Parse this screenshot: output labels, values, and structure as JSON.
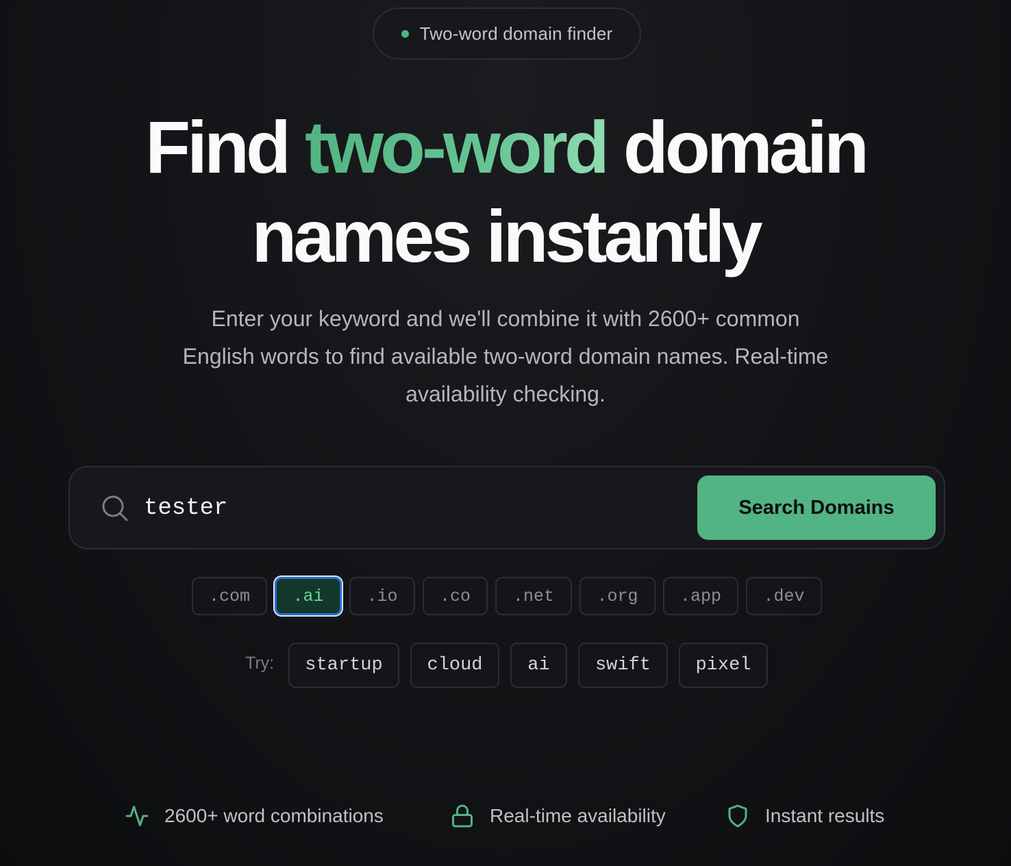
{
  "badge": {
    "text": "Two-word domain finder"
  },
  "headline": {
    "part1": "Find ",
    "accent": "two-word",
    "part2": " domain",
    "line2": "names instantly"
  },
  "subtitle": "Enter your keyword and we'll combine it with 2600+ common English words to find available two-word domain names. Real-time availability checking.",
  "search": {
    "value": "tester",
    "button_label": "Search Domains"
  },
  "tlds": [
    {
      "label": ".com",
      "active": false
    },
    {
      "label": ".ai",
      "active": true
    },
    {
      "label": ".io",
      "active": false
    },
    {
      "label": ".co",
      "active": false
    },
    {
      "label": ".net",
      "active": false
    },
    {
      "label": ".org",
      "active": false
    },
    {
      "label": ".app",
      "active": false
    },
    {
      "label": ".dev",
      "active": false
    }
  ],
  "try": {
    "label": "Try:",
    "suggestions": [
      "startup",
      "cloud",
      "ai",
      "swift",
      "pixel"
    ]
  },
  "features": [
    {
      "icon": "activity-icon",
      "text": "2600+ word combinations"
    },
    {
      "icon": "lock-icon",
      "text": "Real-time availability"
    },
    {
      "icon": "shield-icon",
      "text": "Instant results"
    }
  ],
  "colors": {
    "accent": "#52b383",
    "background": "#141518",
    "active_focus_ring": "#2a6dd6"
  }
}
